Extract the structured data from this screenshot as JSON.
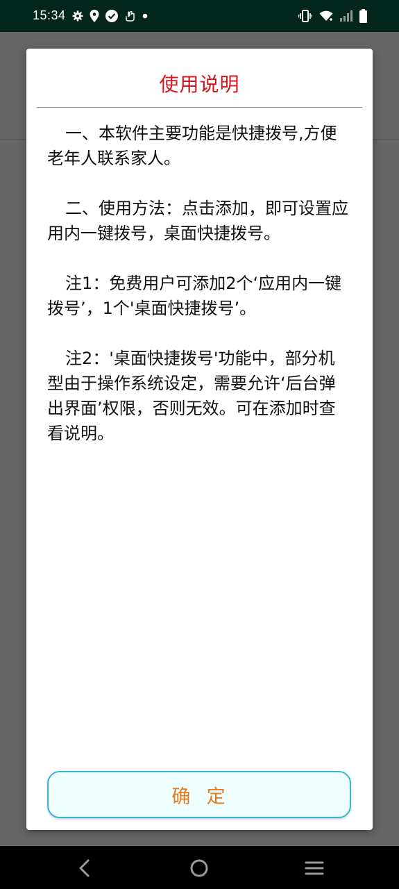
{
  "status_bar": {
    "time": "15:34",
    "background": "#03261c"
  },
  "dialog": {
    "title": "使用说明",
    "title_color": "#d9141c",
    "paragraphs": [
      "一、本软件主要功能是快捷拨号,方便老年人联系家人。",
      "二、使用方法：点击添加，即可设置应用内一键拨号，桌面快捷拨号。",
      "注1：免费用户可添加2个‘应用内一键拨号’，1个'桌面快捷拨号’。",
      "注2：'桌面快捷拨号'功能中，部分机型由于操作系统设定，需要允许‘后台弹出界面’权限，否则无效。可在添加时查看说明。"
    ],
    "confirm_label": "确  定",
    "confirm_text_color": "#e67a1e",
    "confirm_border_color": "#3bb3d6"
  },
  "icons": {
    "status_left": [
      "gear-icon",
      "location-icon",
      "check-circle-icon",
      "hand-icon",
      "dot-icon"
    ],
    "status_right": [
      "vibrate-icon",
      "wifi-icon",
      "signal-icon",
      "battery-icon"
    ],
    "nav": [
      "back-icon",
      "home-icon",
      "menu-icon"
    ]
  }
}
